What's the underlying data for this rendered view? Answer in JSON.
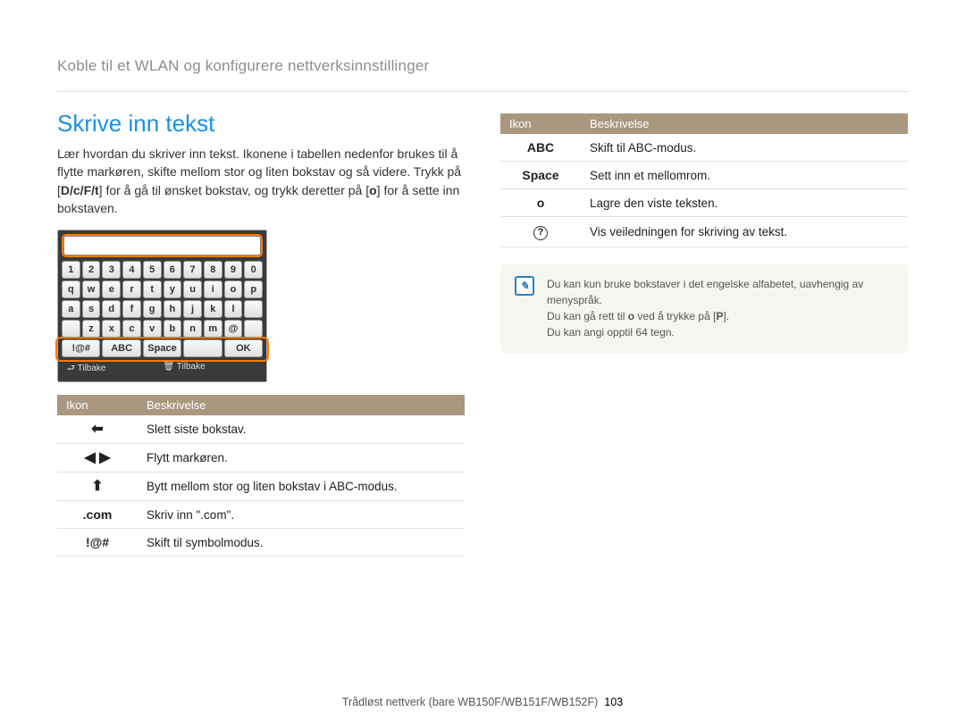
{
  "breadcrumb": "Koble til et WLAN og konfigurere nettverksinnstillinger",
  "section_title": "Skrive inn tekst",
  "intro": {
    "part1": "Lær hvordan du skriver inn tekst. Ikonene i tabellen nedenfor brukes til å flytte markøren, skifte mellom stor og liten bokstav og så videre. Trykk på [",
    "keys": "D/c/F/t",
    "part2": "] for å gå til ønsket bokstav, og trykk deretter på [",
    "key2": "o",
    "part3": "] for å sette inn bokstaven."
  },
  "keyboard": {
    "row1": [
      "1",
      "2",
      "3",
      "4",
      "5",
      "6",
      "7",
      "8",
      "9",
      "0"
    ],
    "row2": [
      "q",
      "w",
      "e",
      "r",
      "t",
      "y",
      "u",
      "i",
      "o",
      "p"
    ],
    "row3": [
      "a",
      "s",
      "d",
      "f",
      "g",
      "h",
      "j",
      "k",
      "l",
      ""
    ],
    "row4": [
      "",
      "z",
      "x",
      "c",
      "v",
      "b",
      "n",
      "m",
      "@",
      ""
    ],
    "row5": [
      "!@#",
      "ABC",
      "Space",
      "",
      "OK"
    ],
    "bottom_left": "Tilbake",
    "bottom_right": "Tilbake"
  },
  "table_headers": {
    "icon": "Ikon",
    "desc": "Beskrivelse"
  },
  "left_table": [
    {
      "icon": "←",
      "desc": "Slett siste bokstav."
    },
    {
      "icon": "◀ ▶",
      "desc": "Flytt markøren."
    },
    {
      "icon": "↑",
      "desc": "Bytt mellom stor og liten bokstav i ABC-modus."
    },
    {
      "icon": ".com",
      "desc": "Skriv inn \".com\"."
    },
    {
      "icon": "!@#",
      "desc": "Skift til symbolmodus."
    }
  ],
  "right_table": [
    {
      "icon": "ABC",
      "desc": "Skift til ABC-modus."
    },
    {
      "icon": "Space",
      "desc": "Sett inn et mellomrom."
    },
    {
      "icon": "o",
      "desc": "Lagre den viste teksten."
    },
    {
      "icon": "?",
      "desc": "Vis veiledningen for skriving av tekst."
    }
  ],
  "note": {
    "line1": "Du kan kun bruke bokstaver i det engelske alfabetet, uavhengig av menyspråk.",
    "line2a": "Du kan gå rett til ",
    "line2b": "o",
    "line2c": " ved å trykke på [",
    "line2d": "P",
    "line2e": "].",
    "line3": "Du kan angi opptil 64 tegn."
  },
  "footer": {
    "text": "Trådløst nettverk (bare WB150F/WB151F/WB152F)",
    "page": "103"
  }
}
